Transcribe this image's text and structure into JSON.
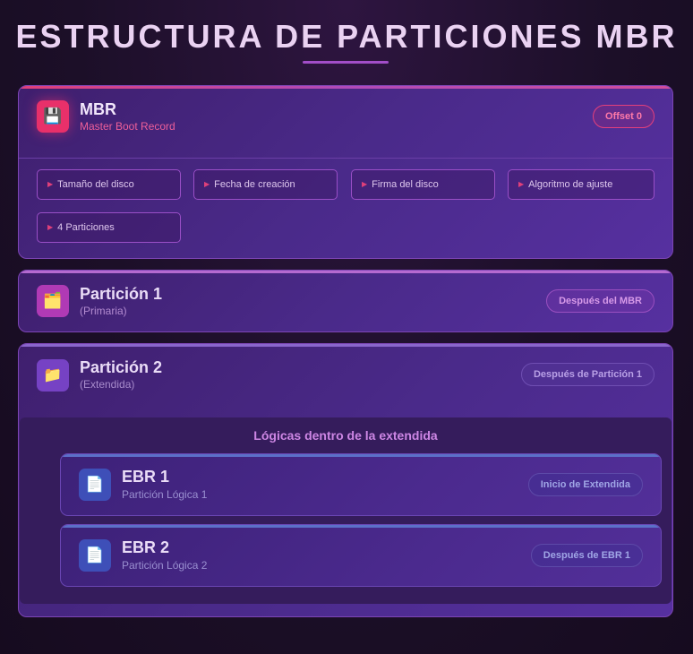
{
  "title": "ESTRUCTURA DE PARTICIONES MBR",
  "mbr": {
    "icon": "floppy-disk-icon",
    "title": "MBR",
    "subtitle": "Master Boot Record",
    "badge": "Offset 0",
    "fields": [
      "Tamaño del disco",
      "Fecha de creación",
      "Firma del disco",
      "Algoritmo de ajuste",
      "4 Particiones"
    ]
  },
  "partition1": {
    "icon": "folder-tabs-icon",
    "title": "Partición 1",
    "subtitle": "(Primaria)",
    "badge": "Después del MBR"
  },
  "partition2": {
    "icon": "folder-icon",
    "title": "Partición 2",
    "subtitle": "(Extendida)",
    "badge": "Después de Partición 1",
    "logical_label": "Lógicas dentro de la extendida",
    "ebrs": [
      {
        "icon": "document-icon",
        "title": "EBR 1",
        "subtitle": "Partición Lógica 1",
        "badge": "Inicio de Extendida"
      },
      {
        "icon": "document-icon",
        "title": "EBR 2",
        "subtitle": "Partición Lógica 2",
        "badge": "Después de EBR 1"
      }
    ]
  },
  "colors": {
    "mbr_accent": "#e8306a",
    "primary_accent": "#b03ab5",
    "extended_accent": "#7642c4",
    "ebr_accent": "#3e4fb8"
  }
}
